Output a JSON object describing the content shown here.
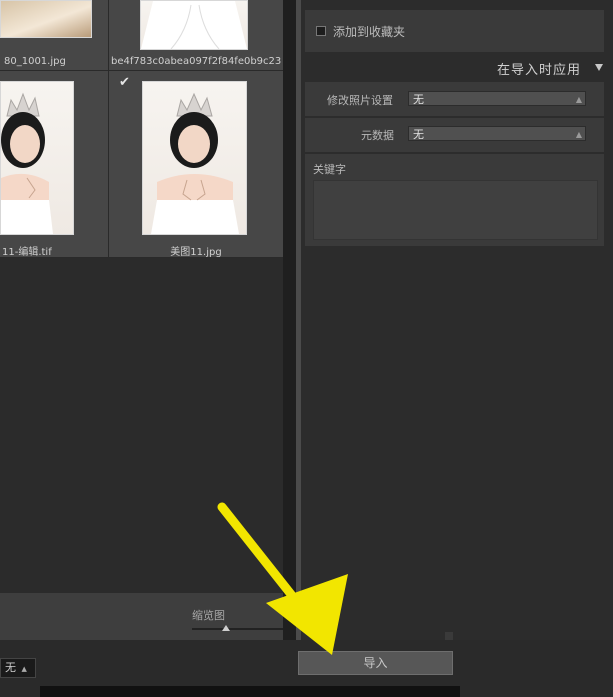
{
  "grid": {
    "thumbnails": [
      {
        "filename": "80_1001.jpg",
        "checked": false
      },
      {
        "filename": "be4f783c0abea097f2f84fe0b9c23...",
        "checked": false
      },
      {
        "filename": "11-编辑.tif",
        "checked": false
      },
      {
        "filename": "美图11.jpg",
        "checked": true
      }
    ],
    "check_glyph": "✔",
    "zoom_label": "缩览图"
  },
  "right_panel": {
    "add_to_collection": "添加到收藏夹",
    "section_title": "在导入时应用",
    "develop_settings": {
      "label": "修改照片设置",
      "value": "无"
    },
    "metadata": {
      "label": "元数据",
      "value": "无"
    },
    "keywords": {
      "label": "关键字",
      "value": ""
    }
  },
  "footer": {
    "left_select_value": "无",
    "import_label": "导入"
  },
  "colors": {
    "annotation_arrow": "#f2e600"
  }
}
